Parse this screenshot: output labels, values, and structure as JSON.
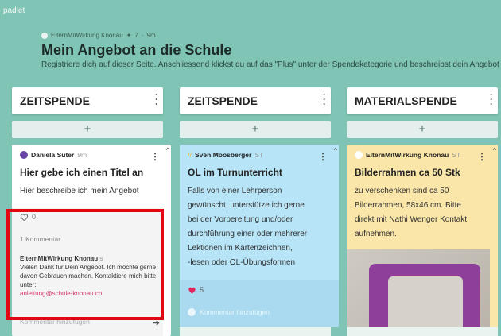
{
  "app": {
    "brand": "padlet"
  },
  "header": {
    "author": "ElternMitWirkung Knonau",
    "star_sep": "✦",
    "likes": "7",
    "age": "9m",
    "title": "Mein Angebot an die Schule",
    "description": "Registriere dich auf dieser Seite. Anschliessend klickst du auf das \"Plus\" unter der Spendekategorie und beschreibst dein Angebot"
  },
  "columns": [
    {
      "title": "ZEITSPENDE",
      "add": "+"
    },
    {
      "title": "ZEITSPENDE",
      "add": "+"
    },
    {
      "title": "MATERIALSPENDE",
      "add": "+"
    }
  ],
  "posts": [
    {
      "author": "Daniela Suter",
      "age": "9m",
      "title": "Hier gebe ich einen Titel an",
      "body": "Hier beschreibe ich mein Angebot",
      "likes": "0",
      "comment_count": "1 Kommentar",
      "comment": {
        "author": "ElternMitWirkung Knonau",
        "age": "s",
        "text": "Vielen Dank für Dein Angebot. Ich möchte gerne davon Gebrauch machen. Kontaktiere mich bitte unter:",
        "email": "anleitung@schule-knonau.ch"
      },
      "comment_placeholder": "Kommentar hinzufügen"
    },
    {
      "author": "Sven Moosberger",
      "age": "ST",
      "title": "OL im Turnunterricht",
      "body_lines": [
        "Falls von einer Lehrperson",
        "gewünscht, unterstütze ich gerne",
        "bei der Vorbereitung und/oder",
        "durchführung einer oder mehrerer",
        "Lektionen im Kartenzeichnen,",
        "-lesen oder OL-Übungsformen"
      ],
      "likes": "5",
      "comment_placeholder": "Kommentar hinzufügen"
    },
    {
      "author": "ElternMitWirkung Knonau",
      "age": "ST",
      "title": "Bilderrahmen ca 50 Stk",
      "body_lines": [
        "zu verschenken sind ca 50",
        "Bilderrahmen, 58x46 cm. Bitte",
        "direkt mit Nathi Wenger Kontakt",
        "aufnehmen."
      ]
    }
  ],
  "colors": {
    "background": "#7fc4b4",
    "card_blue": "#b7e4f7",
    "card_yellow": "#fbe6aa",
    "highlight": "#e30613",
    "like_heart": "#e0245e"
  },
  "icons": [
    "kebab-menu-icon",
    "plus-icon",
    "heart-icon",
    "send-icon",
    "scroll-up-icon"
  ]
}
